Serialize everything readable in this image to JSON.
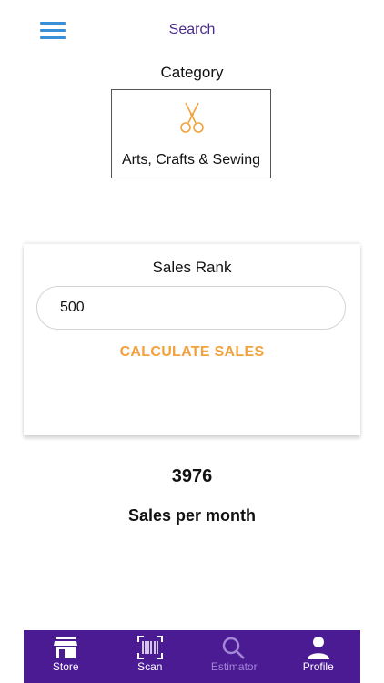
{
  "header": {
    "title": "Search",
    "menu_icon": "hamburger-menu-icon"
  },
  "category": {
    "label": "Category",
    "selected": "Arts, Crafts & Sewing",
    "icon": "scissors-icon",
    "icon_color": "#f2a23c"
  },
  "estimator": {
    "rank_label": "Sales Rank",
    "rank_value": "500",
    "calculate_label": "CALCULATE SALES",
    "accent_color": "#f2a23c"
  },
  "result": {
    "value": "3976",
    "label": "Sales per month"
  },
  "tabbar": {
    "background": "#4b1b94",
    "tabs": [
      {
        "label": "Store",
        "icon": "store-icon"
      },
      {
        "label": "Scan",
        "icon": "barcode-scan-icon"
      },
      {
        "label": "Estimator",
        "icon": "search-icon",
        "active": true
      },
      {
        "label": "Profile",
        "icon": "profile-icon"
      }
    ]
  }
}
